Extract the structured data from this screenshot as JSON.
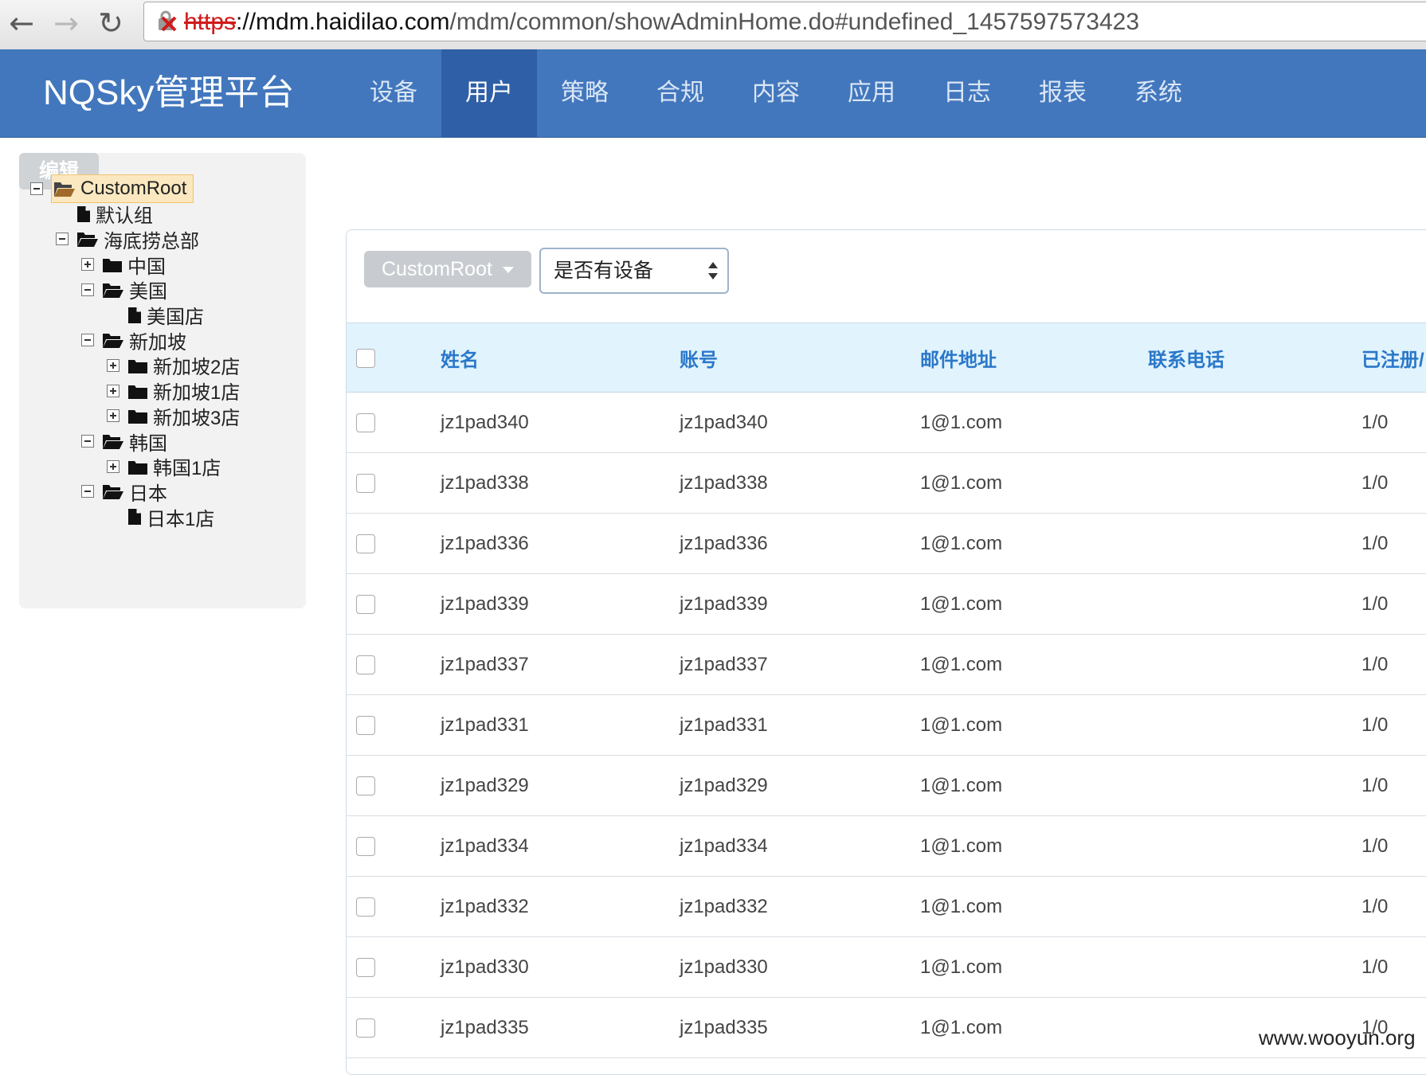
{
  "browser": {
    "url_scheme": "https",
    "url_host": "://mdm.haidilao.com",
    "url_path": "/mdm/common/showAdminHome.do#undefined_1457597573423"
  },
  "app": {
    "brand": "NQSky管理平台",
    "nav": [
      "设备",
      "用户",
      "策略",
      "合规",
      "内容",
      "应用",
      "日志",
      "报表",
      "系统"
    ],
    "active_nav": "用户"
  },
  "sidebar": {
    "edit_label": "编辑",
    "tree": [
      {
        "label": "CustomRoot",
        "type": "folder-open",
        "toggle": "minus",
        "level": 0,
        "selected": true
      },
      {
        "label": "默认组",
        "type": "file",
        "toggle": "none",
        "level": 1
      },
      {
        "label": "海底捞总部",
        "type": "folder-open",
        "toggle": "minus",
        "level": 1
      },
      {
        "label": "中国",
        "type": "folder",
        "toggle": "plus",
        "level": 2
      },
      {
        "label": "美国",
        "type": "folder-open",
        "toggle": "minus",
        "level": 2
      },
      {
        "label": "美国店",
        "type": "file",
        "toggle": "none",
        "level": 3
      },
      {
        "label": "新加坡",
        "type": "folder-open",
        "toggle": "minus",
        "level": 2
      },
      {
        "label": "新加坡2店",
        "type": "folder",
        "toggle": "plus",
        "level": 3
      },
      {
        "label": "新加坡1店",
        "type": "folder",
        "toggle": "plus",
        "level": 3
      },
      {
        "label": "新加坡3店",
        "type": "folder",
        "toggle": "plus",
        "level": 3
      },
      {
        "label": "韩国",
        "type": "folder-open",
        "toggle": "minus",
        "level": 2
      },
      {
        "label": "韩国1店",
        "type": "folder",
        "toggle": "plus",
        "level": 3
      },
      {
        "label": "日本",
        "type": "folder-open",
        "toggle": "minus",
        "level": 2
      },
      {
        "label": "日本1店",
        "type": "file",
        "toggle": "none",
        "level": 3
      }
    ]
  },
  "filters": {
    "group_label": "CustomRoot",
    "device_select_value": "是否有设备"
  },
  "table": {
    "headers": [
      "姓名",
      "账号",
      "邮件地址",
      "联系电话",
      "已注册/"
    ],
    "rows": [
      {
        "name": "jz1pad340",
        "account": "jz1pad340",
        "email": "1@1.com",
        "phone": "",
        "registered": "1/0"
      },
      {
        "name": "jz1pad338",
        "account": "jz1pad338",
        "email": "1@1.com",
        "phone": "",
        "registered": "1/0"
      },
      {
        "name": "jz1pad336",
        "account": "jz1pad336",
        "email": "1@1.com",
        "phone": "",
        "registered": "1/0"
      },
      {
        "name": "jz1pad339",
        "account": "jz1pad339",
        "email": "1@1.com",
        "phone": "",
        "registered": "1/0"
      },
      {
        "name": "jz1pad337",
        "account": "jz1pad337",
        "email": "1@1.com",
        "phone": "",
        "registered": "1/0"
      },
      {
        "name": "jz1pad331",
        "account": "jz1pad331",
        "email": "1@1.com",
        "phone": "",
        "registered": "1/0"
      },
      {
        "name": "jz1pad329",
        "account": "jz1pad329",
        "email": "1@1.com",
        "phone": "",
        "registered": "1/0"
      },
      {
        "name": "jz1pad334",
        "account": "jz1pad334",
        "email": "1@1.com",
        "phone": "",
        "registered": "1/0"
      },
      {
        "name": "jz1pad332",
        "account": "jz1pad332",
        "email": "1@1.com",
        "phone": "",
        "registered": "1/0"
      },
      {
        "name": "jz1pad330",
        "account": "jz1pad330",
        "email": "1@1.com",
        "phone": "",
        "registered": "1/0"
      },
      {
        "name": "jz1pad335",
        "account": "jz1pad335",
        "email": "1@1.com",
        "phone": "",
        "registered": "1/0"
      }
    ]
  },
  "watermark": "www.wooyun.org",
  "colors": {
    "header_bg": "#4277bd",
    "active_nav_bg": "#2f5fa6",
    "table_header_bg": "#e1f3fd",
    "table_header_text": "#2a78c9",
    "insecure_scheme": "#d01a1a"
  }
}
